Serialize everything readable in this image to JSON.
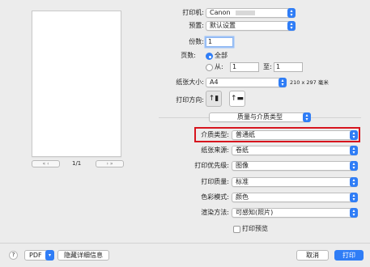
{
  "preview": {
    "page_indicator": "1/1",
    "first_page_glyph": "«",
    "prev_page_glyph": "‹",
    "next_page_glyph": "›",
    "last_page_glyph": "»"
  },
  "printer": {
    "label": "打印机:",
    "value": "Canon"
  },
  "presets": {
    "label": "预置:",
    "value": "默认设置"
  },
  "copies": {
    "label": "份数:",
    "value": "1"
  },
  "pages": {
    "label": "页数:",
    "all_label": "全部",
    "from_label": "从:",
    "from_value": "1",
    "to_label": "至:",
    "to_value": "1"
  },
  "paper_size": {
    "label": "纸张大小:",
    "value": "A4",
    "dimensions": "210 x 297 毫米"
  },
  "orientation": {
    "label": "打印方向:"
  },
  "section_menu": {
    "value": "质量与介质类型"
  },
  "media_type": {
    "label": "介质类型:",
    "value": "普通纸"
  },
  "paper_source": {
    "label": "纸张来源:",
    "value": "卷纸"
  },
  "print_priority": {
    "label": "打印优先级:",
    "value": "图像"
  },
  "print_quality": {
    "label": "打印质量:",
    "value": "标准"
  },
  "color_mode": {
    "label": "色彩模式:",
    "value": "颜色"
  },
  "rendering": {
    "label": "渲染方法:",
    "value": "可感知(照片)"
  },
  "print_preview": {
    "label": "打印预览"
  },
  "footer": {
    "help": "?",
    "pdf": "PDF",
    "hide_details": "隐藏详细信息",
    "cancel": "取消",
    "print": "打印"
  },
  "colors": {
    "accent": "#2f7df6",
    "highlight_border": "#d7151e"
  }
}
